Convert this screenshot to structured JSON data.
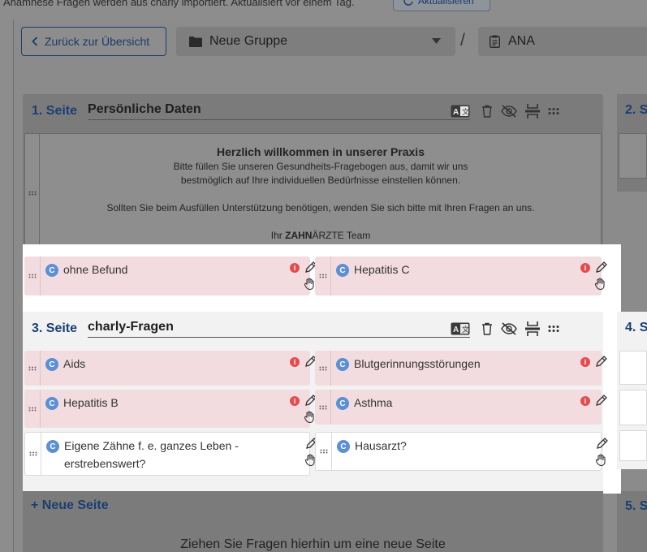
{
  "top": {
    "info_text": "Anamnese Fragen werden aus charly importiert. Aktualisiert vor einem Tag.",
    "refresh_label": "Aktualisieren"
  },
  "toolbar": {
    "back_label": "Zurück zur Übersicht",
    "group_value": "Neue Gruppe",
    "separator": "/",
    "form_value": "ANA"
  },
  "pages": [
    {
      "num_label": "1. Seite",
      "title": "Persönliche Daten",
      "welcome": {
        "title": "Herzlich willkommen in unserer Praxis",
        "line1": "Bitte füllen Sie unseren Gesundheits-Fragebogen aus, damit wir uns",
        "line2": "bestmöglich auf Ihre individuellen Bedürfnisse einstellen können.",
        "line3": "Sollten Sie beim Ausfüllen Unterstützung benötigen, wenden Sie sich bitte mit Ihren Fragen an uns.",
        "sign_prefix": "Ihr ",
        "sign_bold": "ZAHN",
        "sign_suffix": "ÄRZTE Team"
      },
      "questions": [
        {
          "badge": "C",
          "text": "ohne Befund",
          "info": true
        },
        {
          "badge": "C",
          "text": "Hepatitis C",
          "info": true
        }
      ]
    },
    {
      "num_label": "3. Seite",
      "title": "charly-Fragen",
      "questions": [
        {
          "badge": "C",
          "text": "Aids",
          "info": true
        },
        {
          "badge": "C",
          "text": "Blutgerinnungsstörungen",
          "info": true
        },
        {
          "badge": "C",
          "text": "Hepatitis B",
          "info": true
        },
        {
          "badge": "C",
          "text": "Asthma",
          "info": true
        },
        {
          "badge": "C",
          "text": "Eigene Zähne f. e. ganzes Leben - erstrebenswert?",
          "info": false
        },
        {
          "badge": "C",
          "text": "Hausarzt?",
          "info": false
        }
      ]
    }
  ],
  "side_pages": [
    "2. S",
    "4. S",
    "5. S"
  ],
  "new_page": {
    "label": "+ Neue Seite",
    "hint": "Ziehen Sie Fragen hierhin um eine neue Seite"
  },
  "colors": {
    "accent": "#1a3f72",
    "badge": "#5b8fd6",
    "info": "#e34d4d",
    "question_highlight": "#f3dce0"
  }
}
